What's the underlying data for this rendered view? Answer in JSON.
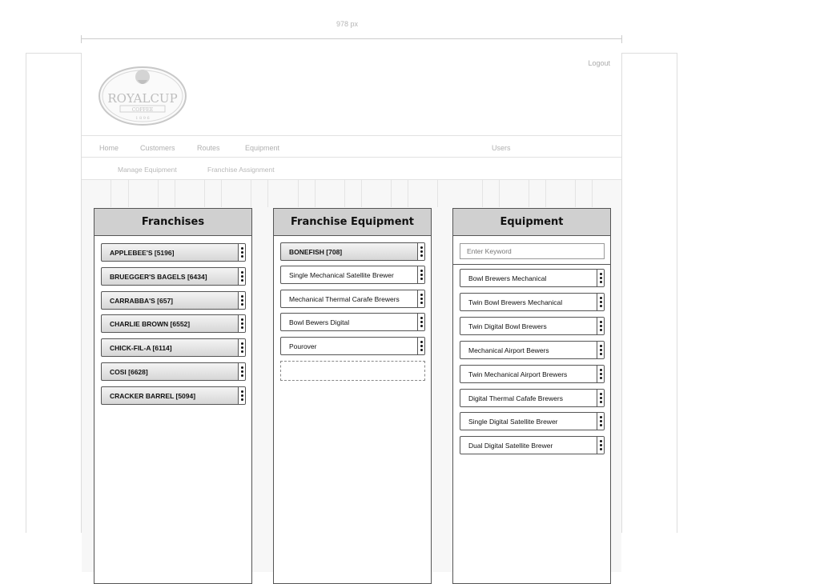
{
  "ruler": {
    "label": "978 px"
  },
  "header": {
    "logout": "Logout",
    "logo_text": "ROYALCUP",
    "logo_sub": "COFFEE",
    "logo_year": "1 8 9 6"
  },
  "nav": {
    "items": [
      "Home",
      "Customers",
      "Routes",
      "Equipment",
      "Users"
    ],
    "sub_items": [
      "Manage Equipment",
      "Franchise Assignment"
    ]
  },
  "franchises": {
    "title": "Franchises",
    "items": [
      "APPLEBEE'S [5196]",
      "BRUEGGER'S BAGELS [6434]",
      "CARRABBA'S [657]",
      "CHARLIE BROWN [6552]",
      "CHICK-FIL-A [6114]",
      "COSI [6628]",
      "CRACKER BARREL [5094]"
    ]
  },
  "franchise_equipment": {
    "title": "Franchise Equipment",
    "selected": "BONEFISH [708]",
    "items": [
      "Single Mechanical Satellite Brewer",
      "Mechanical Thermal Carafe Brewers",
      "Bowl Bewers Digital",
      "Pourover"
    ]
  },
  "equipment": {
    "title": "Equipment",
    "search_placeholder": "Enter Keyword",
    "items": [
      "Bowl Brewers Mechanical",
      "Twin Bowl Brewers Mechanical",
      "Twin Digital Bowl Brewers",
      "Mechanical Airport Bewers",
      "Twin Mechanical Airport Brewers",
      "Digital Thermal Cafafe Brewers",
      "Single Digital Satellite Brewer",
      "Dual Digital Satellite Brewer"
    ]
  }
}
